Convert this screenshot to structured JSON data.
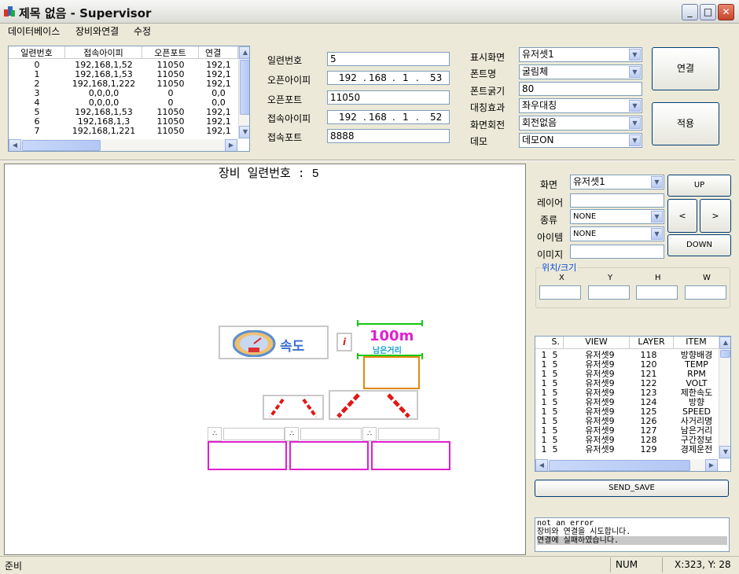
{
  "window": {
    "title": "제목 없음 - Supervisor",
    "min": "_",
    "max": "□",
    "close": "✕"
  },
  "menu": [
    "데이터베이스",
    "장비와연결",
    "수정"
  ],
  "device_table": {
    "headers": [
      "일련번호",
      "접속아이피",
      "오픈포트",
      "연결"
    ],
    "rows": [
      [
        "0",
        "192,168,1,52",
        "11050",
        "192,1"
      ],
      [
        "1",
        "192,168,1,53",
        "11050",
        "192,1"
      ],
      [
        "2",
        "192,168,1,222",
        "11050",
        "192,1"
      ],
      [
        "3",
        "0,0,0,0",
        "0",
        "0,0"
      ],
      [
        "4",
        "0,0,0,0",
        "0",
        "0,0"
      ],
      [
        "5",
        "192,168,1,53",
        "11050",
        "192,1"
      ],
      [
        "6",
        "192,168,1,3",
        "11050",
        "192,1"
      ],
      [
        "7",
        "192,168,1,221",
        "11050",
        "192,1"
      ]
    ]
  },
  "form": {
    "serial_label": "일련번호",
    "serial": "5",
    "open_ip_label": "오픈아이피",
    "open_ip": [
      "192",
      ".",
      "168",
      ".",
      "1",
      ".",
      "53"
    ],
    "open_port_label": "오픈포트",
    "open_port": "11050",
    "conn_ip_label": "접속아이피",
    "conn_ip": [
      "192",
      ".",
      "168",
      ".",
      "1",
      ".",
      "52"
    ],
    "conn_port_label": "접속포트",
    "conn_port": "8888"
  },
  "display": {
    "screen_label": "표시화면",
    "screen": "유저셋1",
    "font_label": "폰트명",
    "font": "굴림체",
    "weight_label": "폰트굵기",
    "weight": "80",
    "sym_label": "대칭효과",
    "sym": "좌우대칭",
    "rot_label": "화면회전",
    "rot": "회전없음",
    "demo_label": "데모",
    "demo": "데모ON"
  },
  "buttons": {
    "connect": "연결",
    "apply": "적용",
    "up": "UP",
    "left": "<",
    "right": ">",
    "down": "DOWN",
    "send_save": "SEND_SAVE"
  },
  "canvas": {
    "device_serial": "장비 일련번호 : 5",
    "speed_text": "속도",
    "distance": "100m",
    "distance_sub": "남은거리",
    "info": "i"
  },
  "right": {
    "screen_label": "화면",
    "screen": "유저셋1",
    "layer_label": "레이어",
    "layer": "",
    "kind_label": "종류",
    "kind": "NONE",
    "item_label": "아이템",
    "item": "NONE",
    "image_label": "이미지",
    "image": "",
    "pos_group": "위치/크기",
    "pos_labels": [
      "X",
      "Y",
      "H",
      "W"
    ]
  },
  "layer_list": {
    "headers": [
      "S.",
      "VIEW",
      "LAYER",
      "ITEM"
    ],
    "rows": [
      [
        "1",
        "5",
        "유저셋9",
        "118",
        "방향배경"
      ],
      [
        "1",
        "5",
        "유저셋9",
        "120",
        "TEMP"
      ],
      [
        "1",
        "5",
        "유저셋9",
        "121",
        "RPM"
      ],
      [
        "1",
        "5",
        "유저셋9",
        "122",
        "VOLT"
      ],
      [
        "1",
        "5",
        "유저셋9",
        "123",
        "제한속도"
      ],
      [
        "1",
        "5",
        "유저셋9",
        "124",
        "방향"
      ],
      [
        "1",
        "5",
        "유저셋9",
        "125",
        "SPEED"
      ],
      [
        "1",
        "5",
        "유저셋9",
        "126",
        "사거리명"
      ],
      [
        "1",
        "5",
        "유저셋9",
        "127",
        "남은거리"
      ],
      [
        "1",
        "5",
        "유저셋9",
        "128",
        "구간정보"
      ],
      [
        "1",
        "5",
        "유저셋9",
        "129",
        "경제운전"
      ]
    ]
  },
  "log": [
    "not an error",
    "장비와 연결을 시도합니다.",
    "연결에 실패하였습니다."
  ],
  "status": {
    "left": "준비",
    "num": "NUM",
    "coords": "X:323, Y: 28"
  },
  "colors": {
    "magenta": "#e020d0",
    "orange": "#e08a10",
    "green": "#12c812",
    "red": "#e01818",
    "accent": "#0b5cd5"
  }
}
